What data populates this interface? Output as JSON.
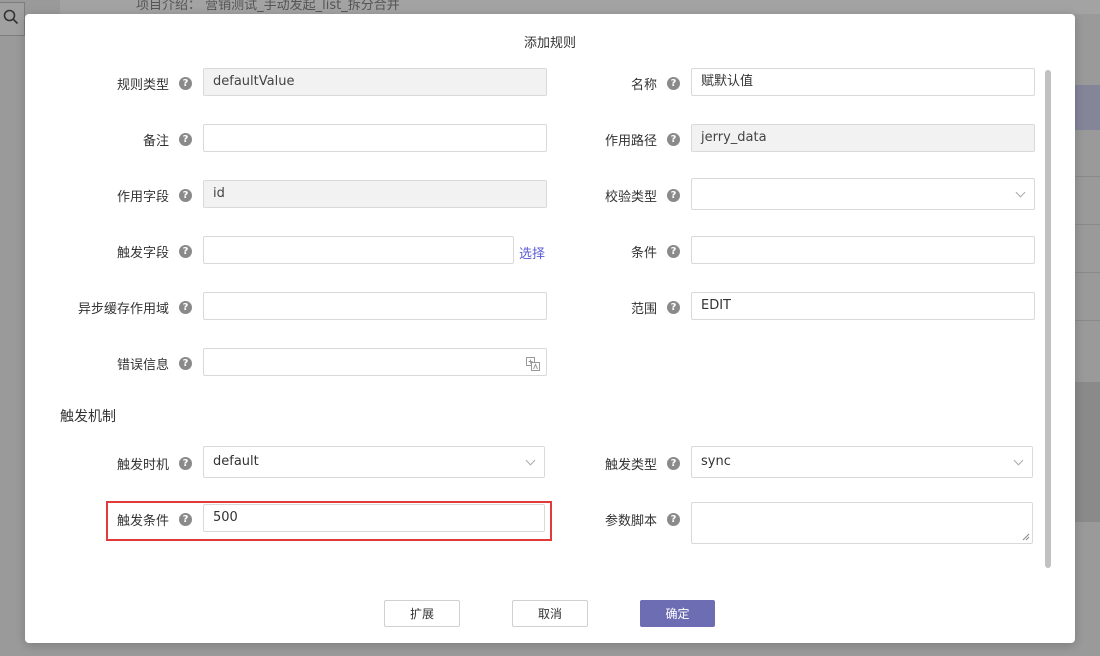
{
  "background": {
    "header_text": "项目介绍： 营销测试_手动发起_list_拆分合并"
  },
  "modal": {
    "title": "添加规则",
    "fields": {
      "rule_type": {
        "label": "规则类型",
        "value": "defaultValue"
      },
      "name": {
        "label": "名称",
        "value": "赋默认值"
      },
      "remark": {
        "label": "备注",
        "value": ""
      },
      "path": {
        "label": "作用路径",
        "value": "jerry_data"
      },
      "field": {
        "label": "作用字段",
        "value": "id"
      },
      "check_type": {
        "label": "校验类型",
        "value": ""
      },
      "trigger_field": {
        "label": "触发字段",
        "value": "",
        "link": "选择"
      },
      "condition": {
        "label": "条件",
        "value": ""
      },
      "async_scope": {
        "label": "异步缓存作用域",
        "value": ""
      },
      "range": {
        "label": "范围",
        "value": "EDIT"
      },
      "error_msg": {
        "label": "错误信息",
        "value": ""
      }
    },
    "trigger_section": {
      "title": "触发机制",
      "timing": {
        "label": "触发时机",
        "value": "default"
      },
      "type": {
        "label": "触发类型",
        "value": "sync"
      },
      "condition": {
        "label": "触发条件",
        "value": "500"
      },
      "script": {
        "label": "参数脚本",
        "value": ""
      }
    },
    "buttons": {
      "extend": "扩展",
      "cancel": "取消",
      "confirm": "确定"
    },
    "help_glyph": "?"
  }
}
